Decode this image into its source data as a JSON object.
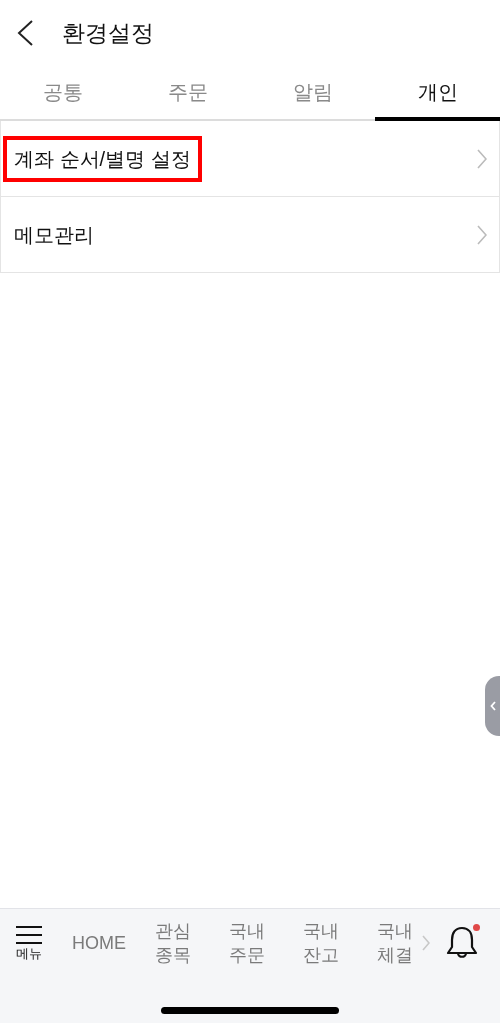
{
  "header": {
    "title": "환경설정"
  },
  "tabs": [
    {
      "label": "공통",
      "selected": false
    },
    {
      "label": "주문",
      "selected": false
    },
    {
      "label": "알림",
      "selected": false
    },
    {
      "label": "개인",
      "selected": true
    }
  ],
  "items": [
    {
      "label": "계좌 순서/별명 설정",
      "highlighted": true
    },
    {
      "label": "메모관리",
      "highlighted": false
    }
  ],
  "bottom_nav": {
    "menu_label": "메뉴",
    "items": [
      "HOME",
      "관심\n종목",
      "국내\n주문",
      "국내\n잔고",
      "국내\n체결"
    ],
    "notification_dot": true
  }
}
